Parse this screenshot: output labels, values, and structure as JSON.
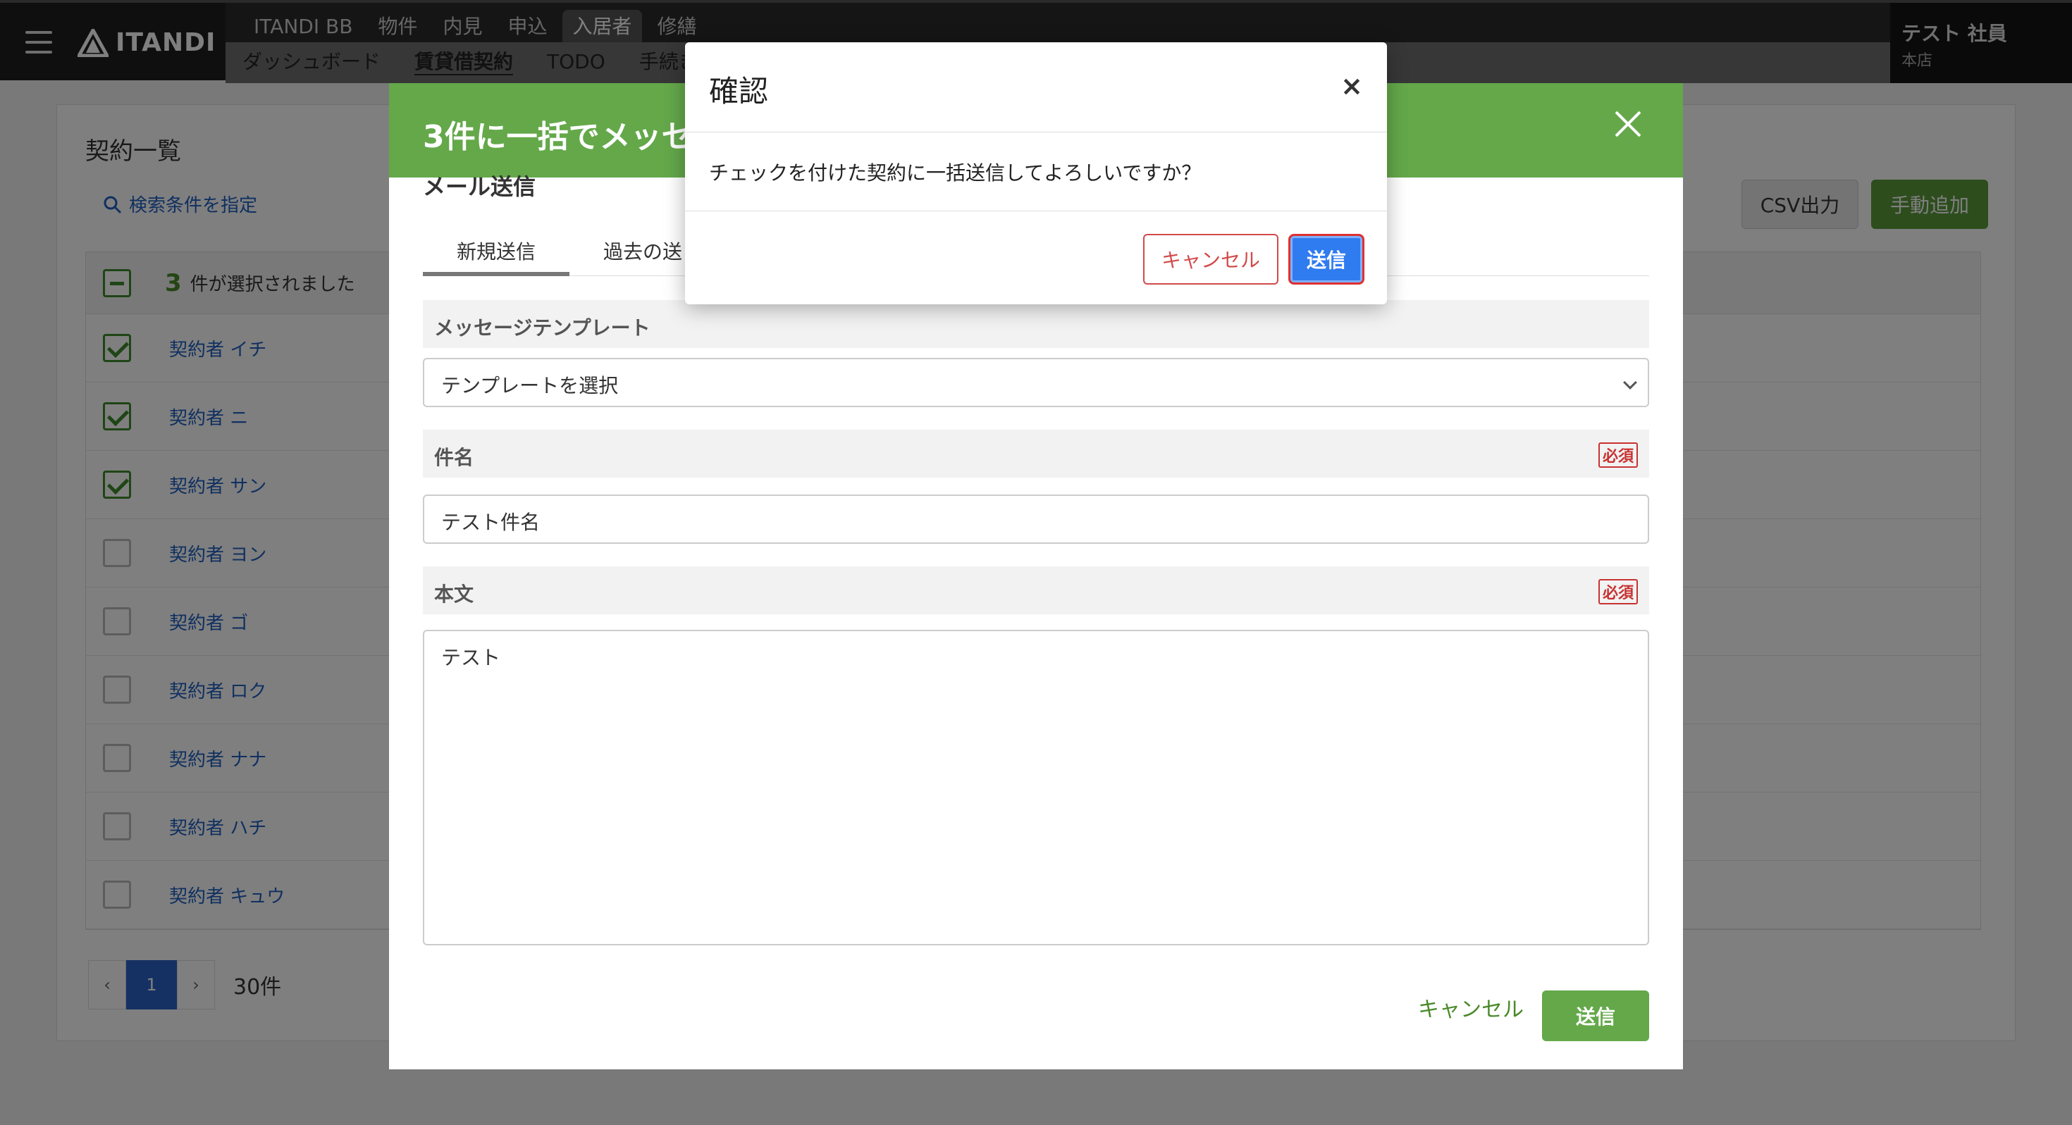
{
  "header": {
    "logo_text": "ITANDI",
    "nav_tabs": [
      "ITANDI BB",
      "物件",
      "内見",
      "申込",
      "入居者",
      "修繕"
    ],
    "active_tab": "入居者",
    "sub_tabs": [
      "ダッシュボード",
      "賃貸借契約",
      "TODO",
      "手続き"
    ],
    "active_sub_tab": "賃貸借契約",
    "user_name": "テスト 社員",
    "user_store": "本店"
  },
  "contracts": {
    "title": "契約一覧",
    "search_link": "検索条件を指定",
    "csv_button": "CSV出力",
    "add_button": "手動追加",
    "selected_count": "3",
    "selected_label": "件が選択されました",
    "rows": [
      {
        "name": "契約者 イチ",
        "checked": true
      },
      {
        "name": "契約者 ニ",
        "checked": true
      },
      {
        "name": "契約者 サン",
        "checked": true
      },
      {
        "name": "契約者 ヨン",
        "checked": false
      },
      {
        "name": "契約者 ゴ",
        "checked": false
      },
      {
        "name": "契約者 ロク",
        "checked": false
      },
      {
        "name": "契約者 ナナ",
        "checked": false
      },
      {
        "name": "契約者 ハチ",
        "checked": false
      },
      {
        "name": "契約者 キュウ",
        "checked": false
      }
    ],
    "pagination": {
      "prev": "‹",
      "current": "1",
      "next": "›",
      "total": "30件"
    }
  },
  "bulk_modal": {
    "title": "3件に一括でメッセー",
    "section_title": "メール送信",
    "tabs": [
      "新規送信",
      "過去の送"
    ],
    "template_label": "メッセージテンプレート",
    "template_value": "テンプレートを選択",
    "subject_label": "件名",
    "subject_value": "テスト件名",
    "body_label": "本文",
    "body_value": "テスト",
    "required_badge": "必須",
    "cancel_label": "キャンセル",
    "send_label": "送信"
  },
  "confirm_dialog": {
    "title": "確認",
    "close_symbol": "×",
    "message": "チェックを付けた契約に一括送信してよろしいですか？",
    "cancel_label": "キャンセル",
    "send_label": "送信"
  },
  "colors": {
    "brand_green": "#64a84a",
    "link_blue": "#2060c0",
    "primary_blue": "#2f7bf0",
    "danger_red": "#d24a4a"
  }
}
